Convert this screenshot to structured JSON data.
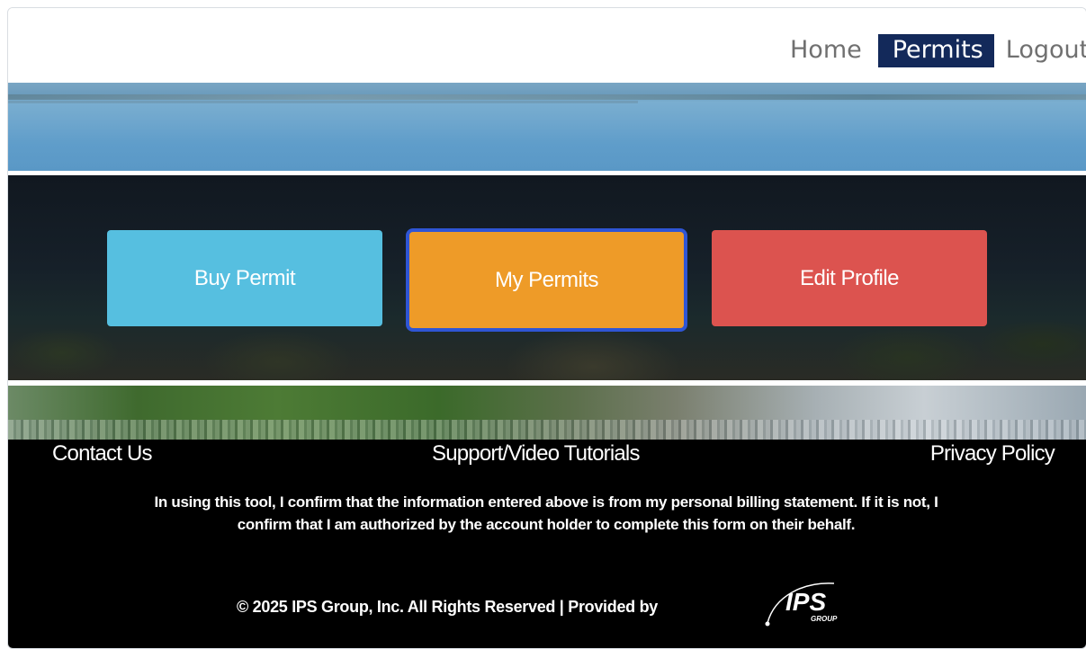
{
  "nav": {
    "items": [
      {
        "label": "Home"
      },
      {
        "label": "Permits",
        "active": true
      },
      {
        "label": "Logout"
      }
    ],
    "active_color": "#13295a"
  },
  "actions": {
    "buy_permit": {
      "label": "Buy Permit",
      "color": "#56bfe0"
    },
    "my_permits": {
      "label": "My Permits",
      "color": "#ee9b28",
      "focused": true
    },
    "edit_profile": {
      "label": "Edit Profile",
      "color": "#dc534f"
    }
  },
  "footer": {
    "links": {
      "contact": "Contact Us",
      "support": "Support/Video Tutorials",
      "privacy": "Privacy Policy"
    },
    "disclaimer": "In using this tool, I confirm that the information entered above is from my personal billing statement. If it is not, I confirm that I am authorized by the account holder to complete this form on their behalf.",
    "copyright": "© 2025 IPS Group, Inc. All Rights Reserved  | Provided by",
    "logo_text": "IPS",
    "logo_subtext": "GROUP"
  }
}
